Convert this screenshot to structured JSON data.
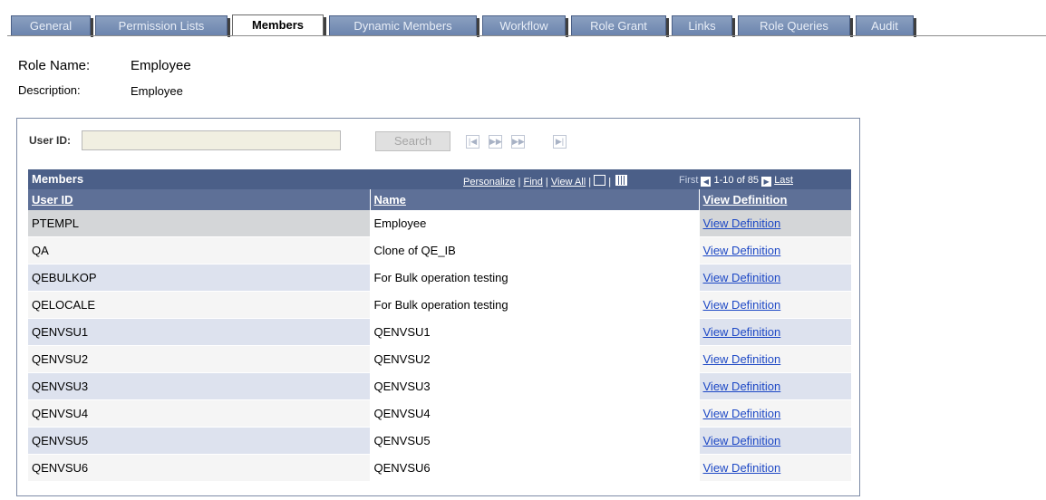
{
  "tabs": [
    {
      "label": "General"
    },
    {
      "label": "Permission Lists"
    },
    {
      "label": "Members",
      "active": true
    },
    {
      "label": "Dynamic Members"
    },
    {
      "label": "Workflow"
    },
    {
      "label": "Role Grant"
    },
    {
      "label": "Links"
    },
    {
      "label": "Role Queries"
    },
    {
      "label": "Audit"
    }
  ],
  "role": {
    "name_label": "Role Name:",
    "name_value": "Employee",
    "desc_label": "Description:",
    "desc_value": "Employee"
  },
  "search": {
    "user_id_label": "User ID:",
    "user_id_value": "",
    "button_label": "Search"
  },
  "grid": {
    "title": "Members",
    "personalize": "Personalize",
    "find": "Find",
    "view_all": "View All",
    "first": "First",
    "range": "1-10 of 85",
    "last": "Last",
    "columns": [
      "User ID",
      "Name",
      "View Definition"
    ],
    "rows": [
      {
        "user_id": "PTEMPL",
        "name": "Employee",
        "link": "View Definition"
      },
      {
        "user_id": "QA",
        "name": "Clone of QE_IB",
        "link": "View Definition"
      },
      {
        "user_id": "QEBULKOP",
        "name": "For Bulk operation testing",
        "link": "View Definition"
      },
      {
        "user_id": "QELOCALE",
        "name": "For Bulk operation testing",
        "link": "View Definition"
      },
      {
        "user_id": "QENVSU1",
        "name": "QENVSU1",
        "link": "View Definition"
      },
      {
        "user_id": "QENVSU2",
        "name": "QENVSU2",
        "link": "View Definition"
      },
      {
        "user_id": "QENVSU3",
        "name": "QENVSU3",
        "link": "View Definition"
      },
      {
        "user_id": "QENVSU4",
        "name": "QENVSU4",
        "link": "View Definition"
      },
      {
        "user_id": "QENVSU5",
        "name": "QENVSU5",
        "link": "View Definition"
      },
      {
        "user_id": "QENVSU6",
        "name": "QENVSU6",
        "link": "View Definition"
      }
    ]
  },
  "colors": {
    "tab_bg": "#7b90b8",
    "grid_header": "#4b5f88",
    "link": "#1d48c5"
  }
}
